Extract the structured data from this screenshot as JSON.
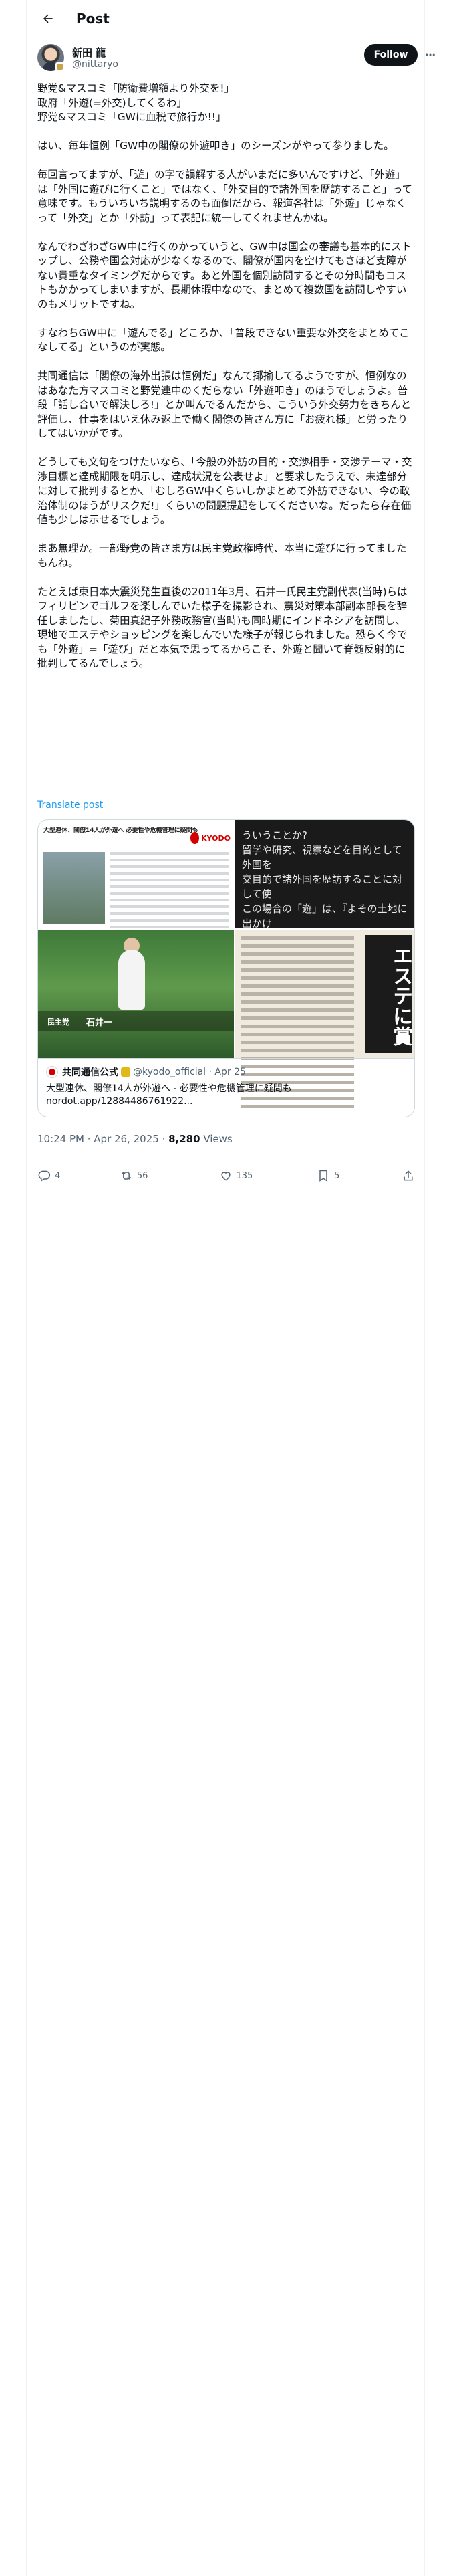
{
  "topbar": {
    "title": "Post"
  },
  "author": {
    "name": "新田 龍",
    "handle": "@nittaryo",
    "follow_label": "Follow"
  },
  "post": {
    "paragraphs": [
      "野党&マスコミ「防衛費増額より外交を!」\n政府「外遊(=外交)してくるわ」\n野党&マスコミ「GWに血税で旅行か!!」",
      "はい、毎年恒例「GW中の閣僚の外遊叩き」のシーズンがやって参りました。",
      "毎回言ってますが、「遊」の字で誤解する人がいまだに多いんですけど、「外遊」は「外国に遊びに行くこと」ではなく、「外交目的で諸外国を歴訪すること」って意味です。もういちいち説明するのも面倒だから、報道各社は「外遊」じゃなくって「外交」とか「外訪」って表記に統一してくれませんかね。",
      "なんでわざわざGW中に行くのかっていうと、GW中は国会の審議も基本的にストップし、公務や国会対応が少なくなるので、閣僚が国内を空けてもさほど支障がない貴重なタイミングだからです。あと外国を個別訪問するとその分時間もコストもかかってしまいますが、長期休暇中なので、まとめて複数国を訪問しやすいのもメリットですね。",
      "すなわちGW中に「遊んでる」どころか、「普段できない重要な外交をまとめてこなしてる」というのが実態。",
      "共同通信は「閣僚の海外出張は恒例だ」なんて揶揄してるようですが、恒例なのはあなた方マスコミと野党連中のくだらない「外遊叩き」のほうでしょうよ。普段「話し合いで解決しろ!」とか叫んでるんだから、こういう外交努力をきちんと評価し、仕事をはいえ休み返上で働く閣僚の皆さん方に「お疲れ様」と労ったりしてはいかがです。",
      "どうしても文句をつけたいなら、「今般の外訪の目的・交渉相手・交渉テーマ・交渉目標と達成期限を明示し、達成状況を公表せよ」と要求したうえで、未達部分に対して批判するとか、「むしろGW中くらいしかまとめて外訪できない、今の政治体制のほうがリスクだ!」くらいの問題提起をしてくださいな。だったら存在価値も少しは示せるでしょう。",
      "まあ無理か。一部野党の皆さま方は民主党政権時代、本当に遊びに行ってましたもんね。",
      "たとえば東日本大震災発生直後の2011年3月、石井一氏民主党副代表(当時)らはフィリピンでゴルフを楽しんでいた様子を撮影され、震災対策本部副本部長を辞任しましたし、菊田真紀子外務政務官(当時)も同時期にインドネシアを訪問し、現地でエステやショッピングを楽しんでいた様子が報じられました。恐らく今でも「外遊」=「遊び」だと本気で思ってるからこそ、外遊と聞いて脊髄反射的に批判してるんでしょう。"
    ],
    "translate_label": "Translate post"
  },
  "quote": {
    "image_headline": "大型連休、閣僚14人が外遊へ 必要性や危機管理に疑問も",
    "kyodo_label": "KYODO",
    "card2_text": "ういうことか?\n留学や研究、視察などを目的として外国を\n交目的で諸外国を歴訪することに対して使\nこの場合の「遊」は、『よその土地に出かけ\nである。",
    "photo_caption": "石井一",
    "caption_tag": "民主党",
    "vertical_title": "エステに賞",
    "author_name": "共同通信公式",
    "author_handle": "@kyodo_official · Apr 25",
    "text": "大型連休、閣僚14人が外遊へ - 必要性や危機管理に疑問も\nnordot.app/12884486761922..."
  },
  "meta": {
    "time": "10:24 PM · Apr 26, 2025 · ",
    "views": "8,280",
    "views_label": " Views"
  },
  "actions": {
    "replies": "4",
    "reposts": "56",
    "likes": "135",
    "bookmarks": "5"
  }
}
